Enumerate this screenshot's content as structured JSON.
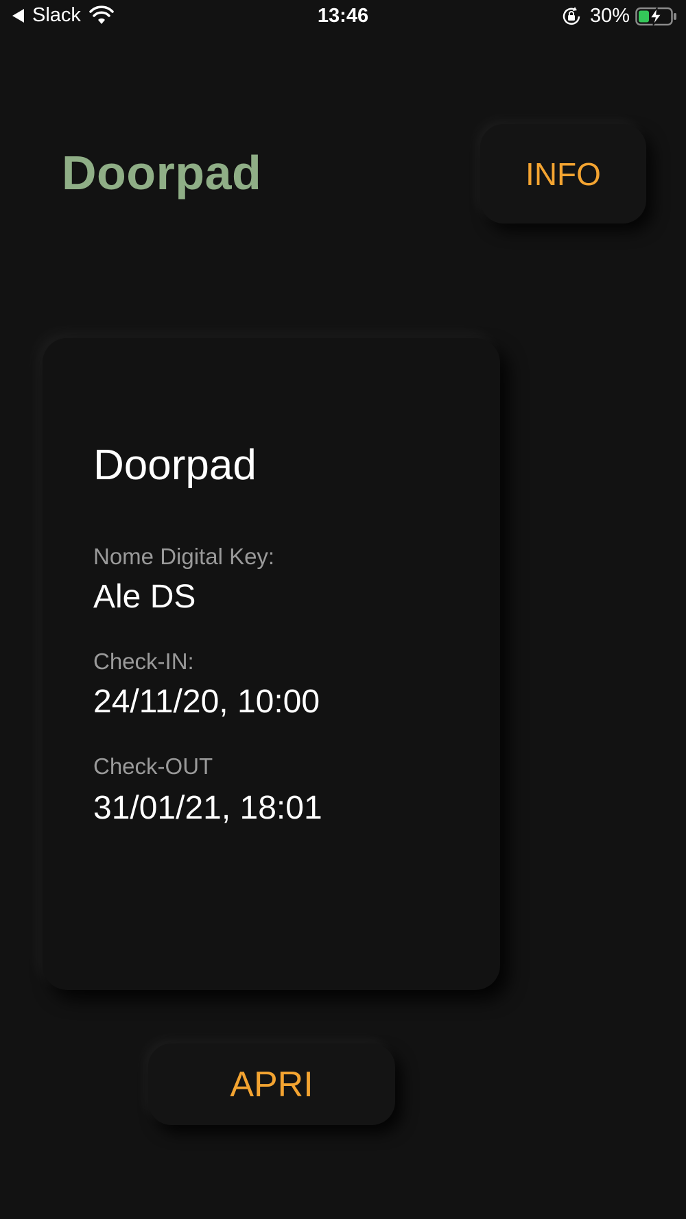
{
  "status_bar": {
    "back_app": "Slack",
    "time": "13:46",
    "battery_percent": "30%"
  },
  "header": {
    "title": "Doorpad",
    "info_label": "INFO"
  },
  "card": {
    "title": "Doorpad",
    "fields": [
      {
        "label": "Nome Digital Key:",
        "value": "Ale DS"
      },
      {
        "label": "Check-IN:",
        "value": "24/11/20, 10:00"
      },
      {
        "label": "Check-OUT",
        "value": "31/01/21, 18:01"
      }
    ]
  },
  "actions": {
    "open_label": "APRI"
  },
  "colors": {
    "background": "#121212",
    "title_green": "#8fae86",
    "accent_orange": "#f4a431",
    "label_gray": "#9a9a9a",
    "battery_green": "#34c759"
  },
  "icons": [
    "back-arrow-icon",
    "wifi-icon",
    "orientation-lock-icon",
    "battery-charging-icon"
  ]
}
